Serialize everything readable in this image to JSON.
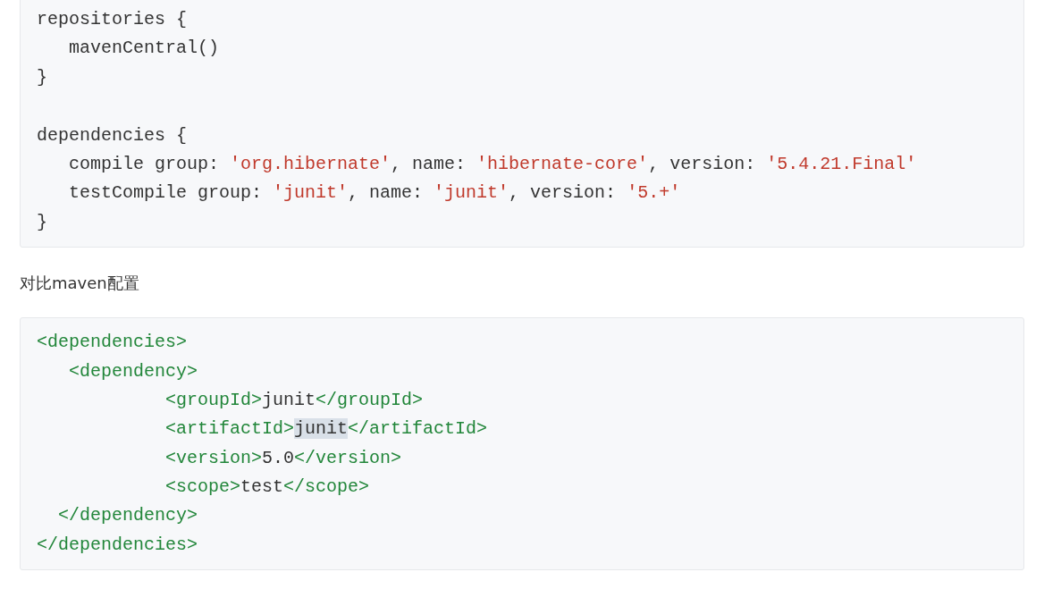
{
  "blocks": [
    {
      "sections": [
        [
          {
            "tokens": [
              {
                "kind": "plain",
                "text": "repositories {"
              }
            ]
          },
          {
            "tokens": [
              {
                "kind": "plain",
                "text": "   mavenCentral()"
              }
            ]
          },
          {
            "tokens": [
              {
                "kind": "plain",
                "text": "}"
              }
            ]
          }
        ],
        [
          {
            "tokens": [
              {
                "kind": "plain",
                "text": "dependencies {"
              }
            ]
          },
          {
            "tokens": [
              {
                "kind": "plain",
                "text": "   compile group: "
              },
              {
                "kind": "string",
                "text": "'org.hibernate'"
              },
              {
                "kind": "plain",
                "text": ", name: "
              },
              {
                "kind": "string",
                "text": "'hibernate-core'"
              },
              {
                "kind": "plain",
                "text": ", version: "
              },
              {
                "kind": "string",
                "text": "'5.4.21.Final'"
              }
            ]
          },
          {
            "tokens": [
              {
                "kind": "plain",
                "text": "   testCompile group: "
              },
              {
                "kind": "string",
                "text": "'junit'"
              },
              {
                "kind": "plain",
                "text": ", name: "
              },
              {
                "kind": "string",
                "text": "'junit'"
              },
              {
                "kind": "plain",
                "text": ", version: "
              },
              {
                "kind": "string",
                "text": "'5.+'"
              }
            ]
          },
          {
            "tokens": [
              {
                "kind": "plain",
                "text": "}"
              }
            ]
          }
        ]
      ]
    },
    {
      "paragraph": "对比maven配置"
    },
    {
      "sections": [
        [
          {
            "tokens": [
              {
                "kind": "tag",
                "text": "<dependencies>"
              }
            ]
          },
          {
            "tokens": [
              {
                "kind": "tag",
                "text": "   <dependency>"
              }
            ]
          },
          {
            "tokens": [
              {
                "kind": "tag",
                "text": "            <groupId>"
              },
              {
                "kind": "plain",
                "text": "junit"
              },
              {
                "kind": "tag",
                "text": "</groupId>"
              }
            ]
          },
          {
            "tokens": [
              {
                "kind": "tag",
                "text": "            <artifactId>"
              },
              {
                "kind": "selected",
                "text": "junit"
              },
              {
                "kind": "tag",
                "text": "</artifactId>"
              }
            ]
          },
          {
            "tokens": [
              {
                "kind": "tag",
                "text": "            <version>"
              },
              {
                "kind": "plain",
                "text": "5.0"
              },
              {
                "kind": "tag",
                "text": "</version>"
              }
            ]
          },
          {
            "tokens": [
              {
                "kind": "tag",
                "text": "            <scope>"
              },
              {
                "kind": "plain",
                "text": "test"
              },
              {
                "kind": "tag",
                "text": "</scope>"
              }
            ]
          },
          {
            "tokens": [
              {
                "kind": "tag",
                "text": "  </dependency>"
              }
            ]
          },
          {
            "tokens": [
              {
                "kind": "tag",
                "text": "</dependencies>"
              }
            ]
          }
        ]
      ]
    }
  ]
}
